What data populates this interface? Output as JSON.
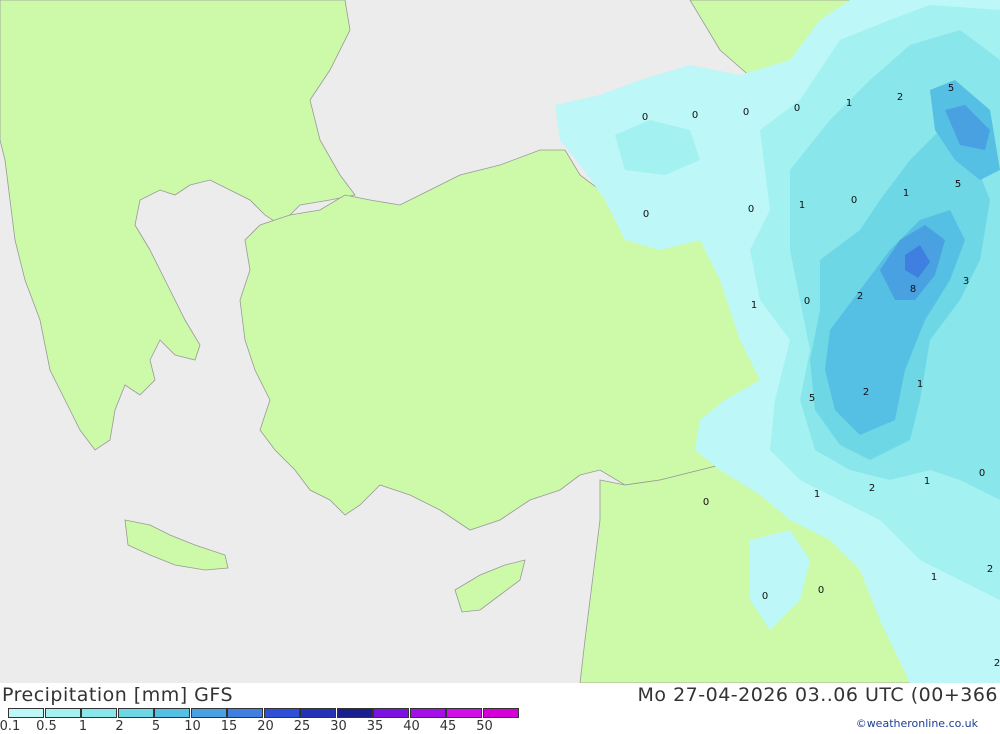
{
  "map": {
    "title": "Precipitation [mm] GFS",
    "valid_time": "Mo 27-04-2026 03..06 UTC (00+366",
    "credit": "©weatheronline.co.uk",
    "colors": {
      "sea": "#ececec",
      "land": "#ccfaa8",
      "border": "#999999"
    }
  },
  "legend": {
    "ticks": [
      "0.1",
      "0.5",
      "1",
      "2",
      "5",
      "10",
      "15",
      "20",
      "25",
      "30",
      "35",
      "40",
      "45",
      "50"
    ],
    "colors": [
      "#bdf7f7",
      "#a4f1f1",
      "#89e6ea",
      "#6dd7e6",
      "#55bfe4",
      "#4aa1e1",
      "#3f7fdf",
      "#2f4fd6",
      "#2432b6",
      "#1a1f8e",
      "#7c12e2",
      "#a30fe6",
      "#cf0fe6",
      "#d400d7"
    ]
  },
  "values": [
    {
      "text": "0",
      "pos": [
        645,
        116
      ]
    },
    {
      "text": "0",
      "pos": [
        695,
        114
      ]
    },
    {
      "text": "0",
      "pos": [
        746,
        111
      ]
    },
    {
      "text": "0",
      "pos": [
        797,
        107
      ]
    },
    {
      "text": "1",
      "pos": [
        849,
        102
      ]
    },
    {
      "text": "2",
      "pos": [
        900,
        96
      ]
    },
    {
      "text": "5",
      "pos": [
        951,
        87
      ]
    },
    {
      "text": "0",
      "pos": [
        646,
        213
      ]
    },
    {
      "text": "0",
      "pos": [
        751,
        208
      ]
    },
    {
      "text": "1",
      "pos": [
        802,
        204
      ]
    },
    {
      "text": "0",
      "pos": [
        854,
        199
      ]
    },
    {
      "text": "1",
      "pos": [
        906,
        192
      ]
    },
    {
      "text": "5",
      "pos": [
        958,
        183
      ]
    },
    {
      "text": "1",
      "pos": [
        754,
        304
      ]
    },
    {
      "text": "0",
      "pos": [
        807,
        300
      ]
    },
    {
      "text": "2",
      "pos": [
        860,
        295
      ]
    },
    {
      "text": "8",
      "pos": [
        913,
        288
      ]
    },
    {
      "text": "3",
      "pos": [
        966,
        280
      ]
    },
    {
      "text": "5",
      "pos": [
        812,
        397
      ]
    },
    {
      "text": "2",
      "pos": [
        866,
        391
      ]
    },
    {
      "text": "1",
      "pos": [
        920,
        383
      ]
    },
    {
      "text": "0",
      "pos": [
        706,
        501
      ]
    },
    {
      "text": "1",
      "pos": [
        817,
        493
      ]
    },
    {
      "text": "2",
      "pos": [
        872,
        487
      ]
    },
    {
      "text": "1",
      "pos": [
        927,
        480
      ]
    },
    {
      "text": "0",
      "pos": [
        982,
        472
      ]
    },
    {
      "text": "0",
      "pos": [
        765,
        595
      ]
    },
    {
      "text": "0",
      "pos": [
        821,
        589
      ]
    },
    {
      "text": "1",
      "pos": [
        934,
        576
      ]
    },
    {
      "text": "2",
      "pos": [
        990,
        568
      ]
    },
    {
      "text": "2",
      "pos": [
        997,
        662
      ]
    }
  ]
}
